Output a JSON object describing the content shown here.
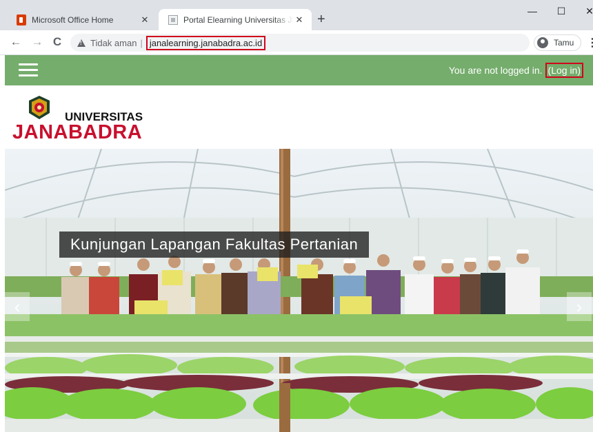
{
  "browser": {
    "tabs": [
      {
        "title": "Microsoft Office Home",
        "icon": "office-icon",
        "active": false
      },
      {
        "title": "Portal Elearning Universitas Janabadra",
        "icon": "moodle-icon",
        "active": true
      }
    ],
    "new_tab": "+",
    "window_controls": {
      "minimize": "—",
      "maximize": "☐",
      "close": "✕"
    },
    "nav": {
      "back": "←",
      "forward": "→",
      "reload": "C"
    },
    "omnibox": {
      "security_label": "Tidak aman",
      "divider": "|",
      "url": "janalearning.janabadra.ac.id"
    },
    "profile": {
      "label": "Tamu"
    },
    "menu": "⋮"
  },
  "navbar": {
    "menu_icon": "hamburger-icon",
    "login_status": "You are not logged in.",
    "login_link": "(Log in)",
    "bg_color": "#75ad6c"
  },
  "logo": {
    "line1": "UNIVERSITAS",
    "line2": "JANABADRA",
    "accent_color": "#c8102e"
  },
  "slider": {
    "caption": "Kunjungan Lapangan Fakultas Pertanian",
    "prev": "‹",
    "next": "›"
  }
}
